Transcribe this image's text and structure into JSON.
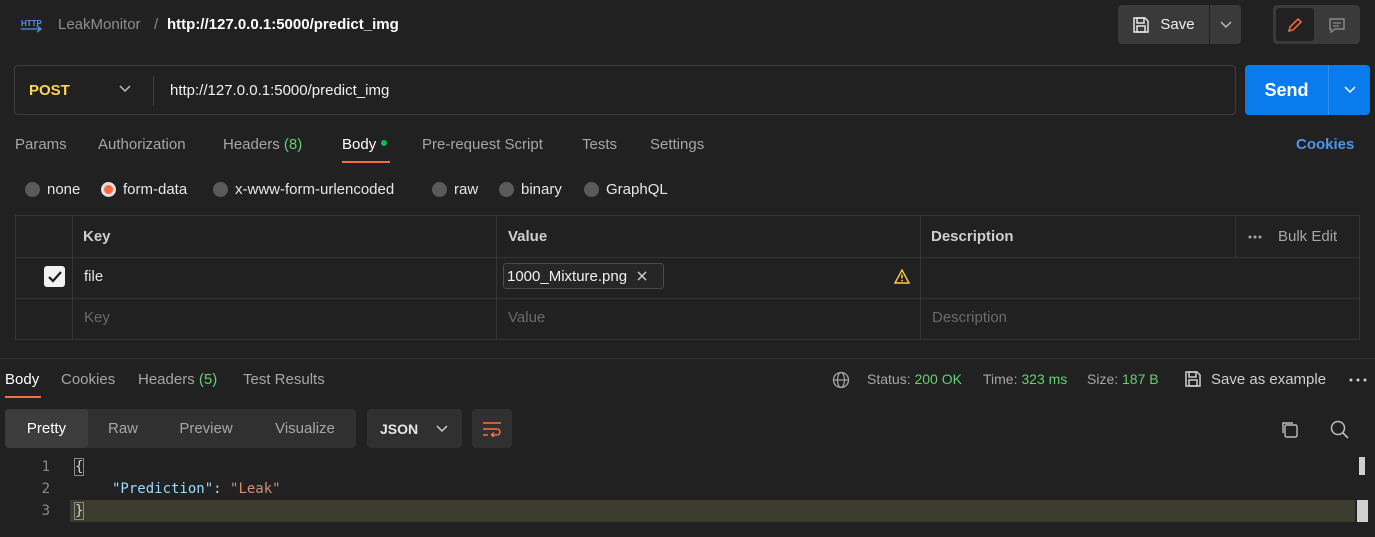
{
  "header": {
    "http_icon": "http-icon",
    "collection": "LeakMonitor",
    "separator": "/",
    "request_name": "http://127.0.0.1:5000/predict_img",
    "save_label": "Save"
  },
  "request": {
    "method": "POST",
    "url": "http://127.0.0.1:5000/predict_img",
    "send_label": "Send"
  },
  "tabs": {
    "params": "Params",
    "authorization": "Authorization",
    "headers": "Headers",
    "headers_count": "(8)",
    "body": "Body",
    "prerequest": "Pre-request Script",
    "tests": "Tests",
    "settings": "Settings",
    "cookies": "Cookies"
  },
  "body_types": {
    "none": "none",
    "form_data": "form-data",
    "urlencoded": "x-www-form-urlencoded",
    "raw": "raw",
    "binary": "binary",
    "graphql": "GraphQL",
    "selected": "form-data"
  },
  "table": {
    "headers": {
      "key": "Key",
      "value": "Value",
      "description": "Description",
      "bulk_edit": "Bulk Edit"
    },
    "rows": [
      {
        "checked": true,
        "key": "file",
        "value": "1000_Mixture.png",
        "description": ""
      }
    ],
    "placeholders": {
      "key": "Key",
      "value": "Value",
      "description": "Description"
    }
  },
  "response": {
    "tabs": {
      "body": "Body",
      "cookies": "Cookies",
      "headers": "Headers",
      "headers_count": "(5)",
      "test_results": "Test Results"
    },
    "status_label": "Status:",
    "status_value": "200 OK",
    "time_label": "Time:",
    "time_value": "323 ms",
    "size_label": "Size:",
    "size_value": "187 B",
    "save_example": "Save as example",
    "views": {
      "pretty": "Pretty",
      "raw": "Raw",
      "preview": "Preview",
      "visualize": "Visualize"
    },
    "format": "JSON",
    "code": {
      "line_numbers": [
        "1",
        "2",
        "3"
      ],
      "open_brace": "{",
      "key": "\"Prediction\"",
      "colon": ": ",
      "value": "\"Leak\"",
      "close_brace": "}"
    }
  },
  "colors": {
    "accent": "#ff6c37",
    "send": "#097bed",
    "method": "#ffd557",
    "success": "#62d26f",
    "link": "#4f94e8"
  }
}
